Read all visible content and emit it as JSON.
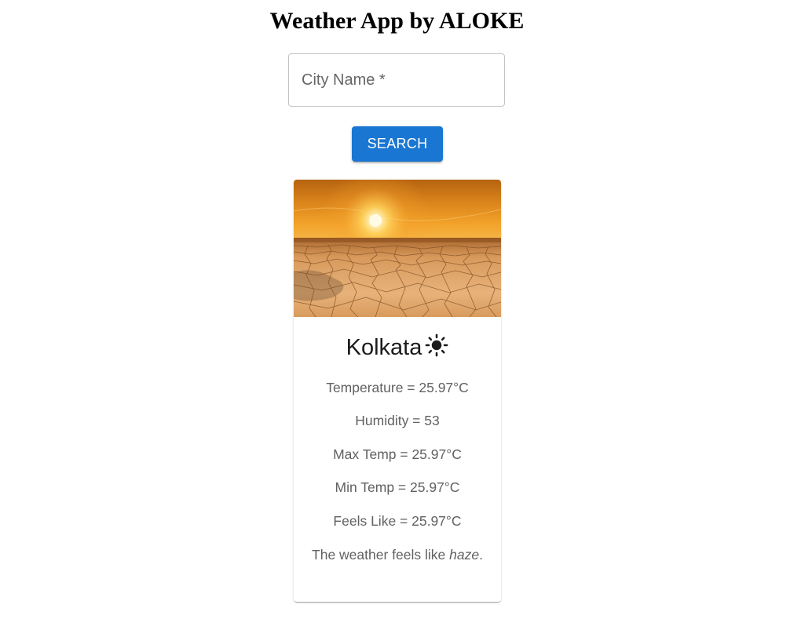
{
  "app": {
    "title": "Weather App by ALOKE"
  },
  "search": {
    "placeholder": "City Name *",
    "value": "",
    "button_label": "SEARCH"
  },
  "weather": {
    "city": "Kolkata",
    "condition_icon": "sun-icon",
    "temperature": "Temperature = 25.97°C",
    "humidity": "Humidity = 53",
    "max_temp": "Max Temp = 25.97°C",
    "min_temp": "Min Temp = 25.97°C",
    "feels_like": "Feels Like = 25.97°C",
    "description_prefix": "The weather feels like ",
    "description": "haze",
    "description_suffix": "."
  },
  "colors": {
    "accent": "#1976d2"
  }
}
